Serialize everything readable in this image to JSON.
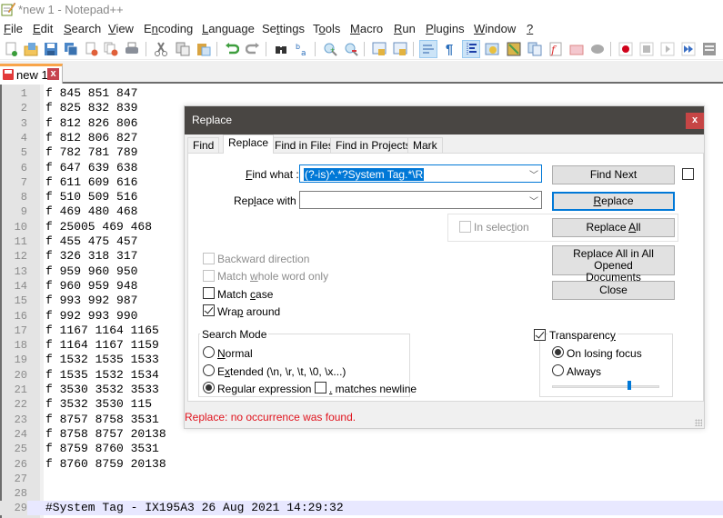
{
  "window": {
    "title": "*new 1 - Notepad++"
  },
  "menu": [
    {
      "label": "File",
      "ul": "F",
      "rest": "ile"
    },
    {
      "label": "Edit",
      "ul": "E",
      "rest": "dit"
    },
    {
      "label": "Search",
      "ul": "S",
      "rest": "earch"
    },
    {
      "label": "View",
      "ul": "V",
      "rest": "iew"
    },
    {
      "label": "Encoding",
      "ul": "n",
      "pre": "E",
      "rest": "coding"
    },
    {
      "label": "Language",
      "ul": "L",
      "rest": "anguage"
    },
    {
      "label": "Settings",
      "ul": "t",
      "pre": "Se",
      "rest": "tings"
    },
    {
      "label": "Tools",
      "ul": "o",
      "pre": "T",
      "rest": "ols"
    },
    {
      "label": "Macro",
      "ul": "M",
      "rest": "acro"
    },
    {
      "label": "Run",
      "ul": "R",
      "rest": "un"
    },
    {
      "label": "Plugins",
      "ul": "P",
      "rest": "lugins"
    },
    {
      "label": "Window",
      "ul": "W",
      "rest": "indow"
    },
    {
      "label": "?",
      "ul": "?",
      "rest": ""
    }
  ],
  "toolbar": {
    "buttons": [
      "new-file-icon",
      "open-file-icon",
      "save-icon",
      "save-all-icon",
      "close-icon",
      "close-all-icon",
      "print-icon",
      "cut-icon",
      "copy-icon",
      "paste-icon",
      "undo-icon",
      "redo-icon",
      "find-icon",
      "replace-icon",
      "zoom-in-icon",
      "zoom-out-icon",
      "sync-vertical-icon",
      "sync-horizontal-icon",
      "word-wrap-icon",
      "show-all-chars-icon",
      "indent-guide-icon",
      "udl-icon",
      "doc-map-icon",
      "doc-list-icon",
      "function-list-icon",
      "folder-workspace-icon",
      "monitoring-icon",
      "record-macro-icon",
      "stop-record-icon",
      "play-macro-icon",
      "run-macro-multiple-icon",
      "save-macro-icon"
    ]
  },
  "tab": {
    "label": "new 1",
    "close": "x"
  },
  "editor": {
    "lines": [
      "f 845 851 847",
      "f 825 832 839",
      "f 812 826 806",
      "f 812 806 827",
      "f 782 781 789",
      "f 647 639 638",
      "f 611 609 616",
      "f 510 509 516",
      "f 469 480 468",
      "f 25005 469 468",
      "f 455 475 457",
      "f 326 318 317",
      "f 959 960 950",
      "f 960 959 948",
      "f 993 992 987",
      "f 992 993 990",
      "f 1167 1164 1165",
      "f 1164 1167 1159",
      "f 1532 1535 1533",
      "f 1535 1532 1534",
      "f 3530 3532 3533",
      "f 3532 3530 115",
      "f 8757 8758 3531",
      "f 8758 8757 20138",
      "f 8759 8760 3531",
      "f 8760 8759 20138",
      "",
      "",
      "#System Tag - IX195A3 26 Aug 2021 14:29:32"
    ],
    "current_line": 29
  },
  "dialog": {
    "title": "Replace",
    "close": "x",
    "tabs": [
      "Find",
      "Replace",
      "Find in Files",
      "Find in Projects",
      "Mark"
    ],
    "active_tab": "Replace",
    "find_what": {
      "label_ul": "F",
      "label_rest": "ind what :",
      "value": "(?-is)^.*?System Tag.*\\R"
    },
    "replace_with": {
      "label_pre": "Rep",
      "label_ul": "l",
      "label_rest": "ace with :",
      "value": ""
    },
    "in_selection": {
      "label_pre": "In selec",
      "label_ul": "t",
      "label_rest": "ion",
      "checked": false,
      "enabled": false
    },
    "buttons": {
      "find_next": "Find Next",
      "replace_ul": "R",
      "replace_rest": "eplace",
      "replace_all_pre": "Replace ",
      "replace_all_ul": "A",
      "replace_all_rest": "ll",
      "replace_all_opened_line1": "Replace All in All Opened",
      "replace_all_opened_pre": "Doc",
      "replace_all_opened_ul": "u",
      "replace_all_opened_rest": "ments",
      "close": "Close"
    },
    "options": {
      "backward": {
        "label": "Backward direction",
        "checked": false,
        "enabled": false
      },
      "whole_word": {
        "pre": "Match ",
        "ul": "w",
        "rest": "hole word only",
        "checked": false,
        "enabled": false
      },
      "match_case": {
        "pre": "Match ",
        "ul": "c",
        "rest": "ase",
        "checked": false,
        "enabled": true
      },
      "wrap_around": {
        "pre": "Wra",
        "ul": "p",
        "rest": " around",
        "checked": true,
        "enabled": true
      }
    },
    "search_mode": {
      "title": "Search Mode",
      "normal": {
        "ul": "N",
        "rest": "ormal"
      },
      "extended": {
        "pre": "E",
        "ul": "x",
        "rest": "tended (\\n, \\r, \\t, \\0, \\x...)"
      },
      "regex": {
        "pre": "Re",
        "ul": "g",
        "rest": "ular expression"
      },
      "selected": "regex",
      "dot_newline": {
        "ul": ".",
        "rest": " matches newline",
        "checked": false
      }
    },
    "transparency": {
      "pre": "Transparenc",
      "ul": "y",
      "checked": true,
      "on_losing_focus": "On losing focus",
      "always": "Always",
      "selected": "on_losing_focus",
      "level_fraction": 0.72
    },
    "status": "Replace: no occurrence was found."
  }
}
